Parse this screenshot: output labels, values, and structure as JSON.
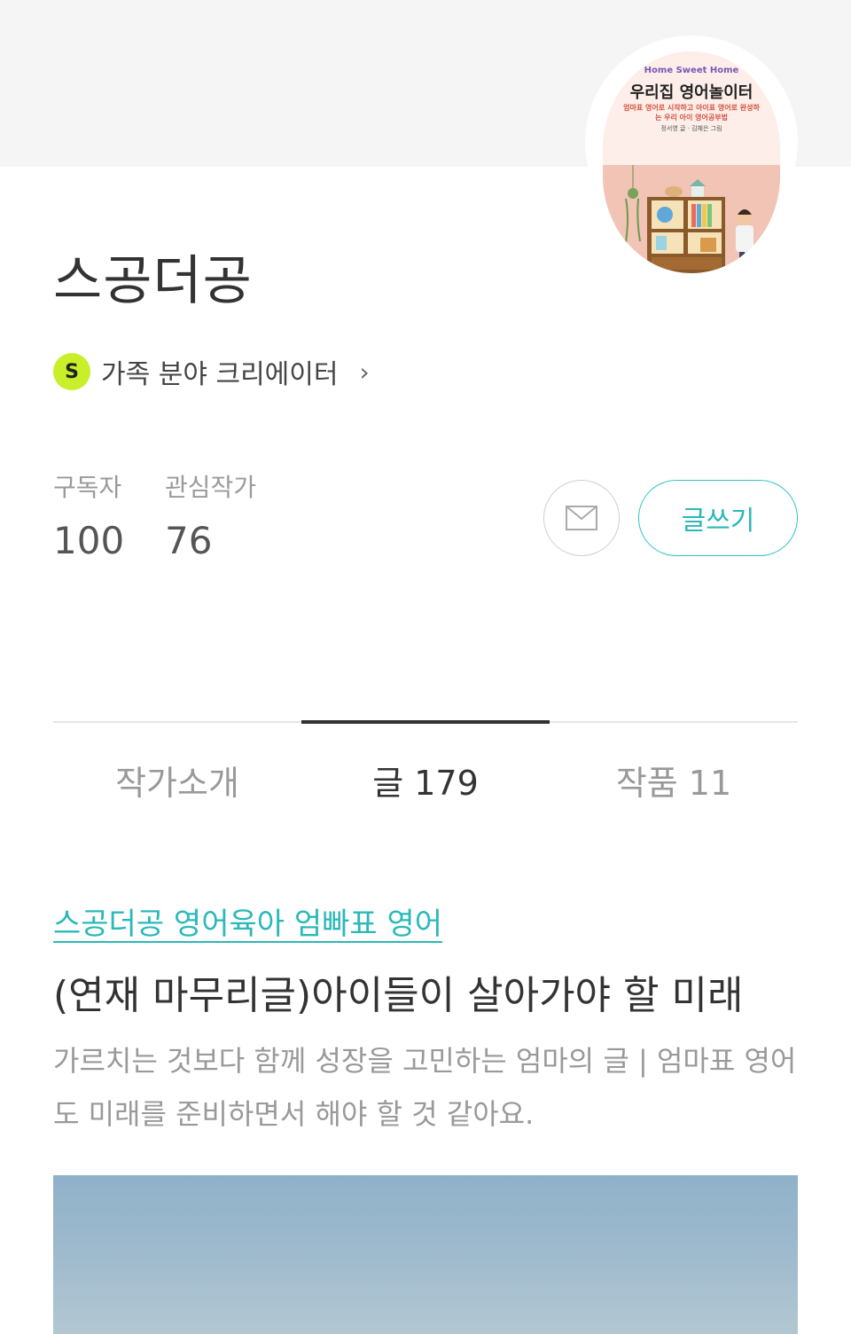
{
  "header": {
    "profile": {
      "cover_subtitle": "Home Sweet Home",
      "cover_title": "우리집 영어놀이터",
      "cover_description": "엄마표 영어로 시작하고 아이표 영어로 완성하는 우리 아이 영어공부법",
      "cover_authors": "정서영 글 · 김혜은 그림"
    }
  },
  "author": {
    "name": "스공더공",
    "category_badge": "S",
    "category_label": "가족 분야 크리에이터",
    "category_chevron": "›"
  },
  "stats": {
    "subscribers_label": "구독자",
    "subscribers_value": "100",
    "following_label": "관심작가",
    "following_value": "76"
  },
  "actions": {
    "mail_icon": "envelope-icon",
    "write_label": "글쓰기"
  },
  "tabs": [
    {
      "label": "작가소개",
      "active": false
    },
    {
      "label": "글 179",
      "active": true
    },
    {
      "label": "작품 11",
      "active": false
    }
  ],
  "post": {
    "category": "스공더공 영어육아 엄빠표 영어",
    "title": "(연재 마무리글)아이들이 살아가야 할 미래",
    "excerpt": "가르치는 것보다 함께 성장을 고민하는 엄마의 글 | 엄마표 영어도 미래를 준비하면서 해야 할 것 같아요."
  },
  "colors": {
    "accent": "#2bb8b8",
    "badge": "#c8ef29",
    "top_band": "#f5f5f5"
  }
}
